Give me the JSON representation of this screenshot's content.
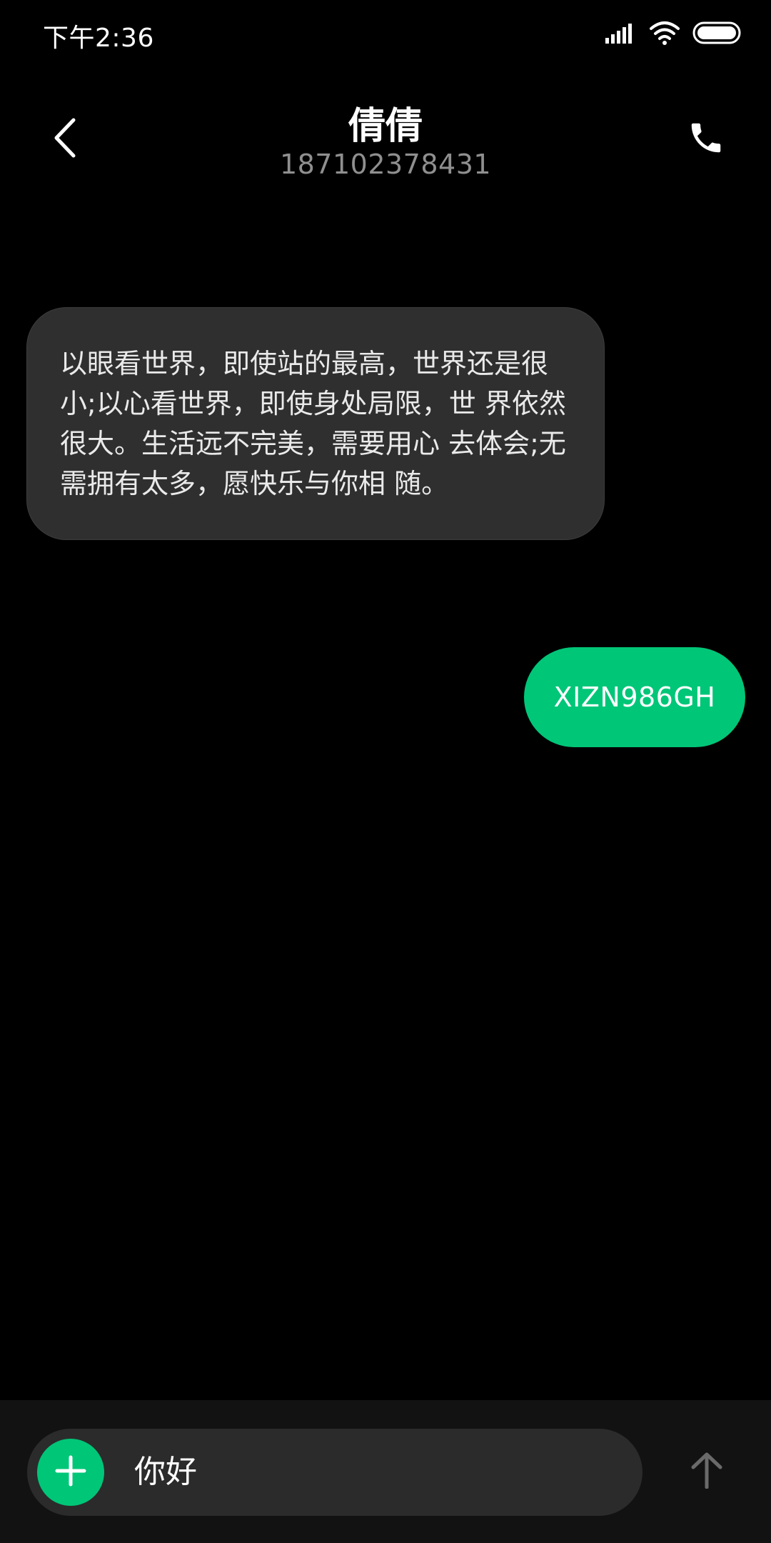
{
  "status_bar": {
    "time": "下午2:36",
    "icons": [
      "signal-icon",
      "wifi-icon",
      "battery-icon"
    ]
  },
  "header": {
    "contact_name": "倩倩",
    "contact_number": "187102378431",
    "back_icon": "back-arrow-icon",
    "call_icon": "phone-icon"
  },
  "messages": [
    {
      "direction": "incoming",
      "text": "以眼看世界，即使站的最高，世界还是很小;以心看世界，即使身处局限，世 界依然很大。生活远不完美，需要用心 去体会;无需拥有太多，愿快乐与你相 随。"
    },
    {
      "direction": "outgoing",
      "text": "XIZN986GH"
    }
  ],
  "composer": {
    "input_value": "你好",
    "add_icon": "plus-icon",
    "send_icon": "send-arrow-icon"
  },
  "colors": {
    "accent": "#00c678",
    "background": "#000000",
    "incoming_bubble": "#2f2f2f",
    "input_bar": "#121212",
    "secondary_text": "#8f8f8f"
  }
}
